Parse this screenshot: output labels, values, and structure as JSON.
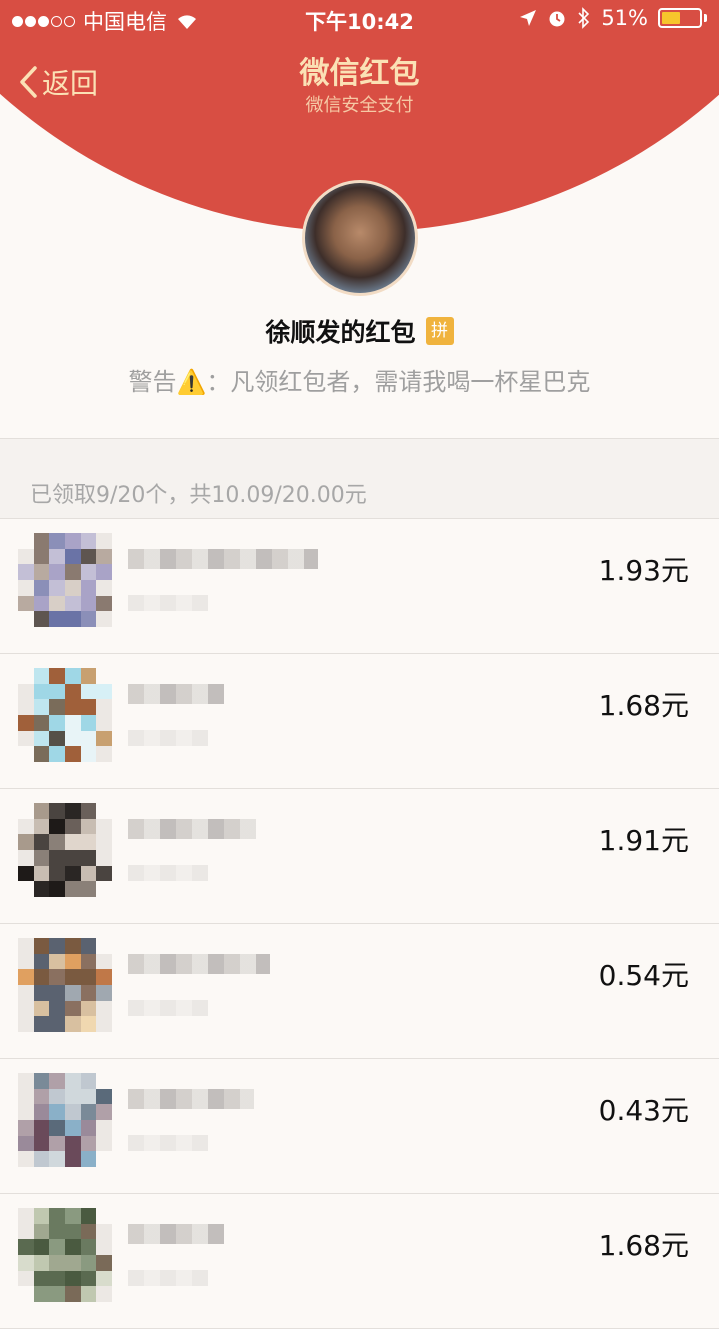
{
  "status_bar": {
    "carrier": "中国电信",
    "time": "下午10:42",
    "battery": "51%",
    "battery_level": 0.51,
    "signal_dots": 3,
    "signal_total": 5,
    "icons": [
      "wifi-icon",
      "location-arrow-icon",
      "alarm-icon",
      "bluetooth-icon",
      "battery-icon"
    ]
  },
  "nav": {
    "back_label": "返回",
    "title": "微信红包",
    "subtitle": "微信安全支付"
  },
  "packet": {
    "sender_label": "徐顺发的红包",
    "badge": "拼",
    "greeting": "警告⚠️：凡领红包者，需请我喝一杯星巴克"
  },
  "summary": "已领取9/20个，共10.09/20.00元",
  "colors": {
    "header_red": "#d84e43",
    "gold_text": "#fbe1b5",
    "badge_orange": "#f0b33d",
    "page_bg": "#fcf9f6"
  },
  "recipients": [
    {
      "amount": "1.93元"
    },
    {
      "amount": "1.68元"
    },
    {
      "amount": "1.91元"
    },
    {
      "amount": "0.54元"
    },
    {
      "amount": "0.43元"
    },
    {
      "amount": "1.68元"
    }
  ]
}
